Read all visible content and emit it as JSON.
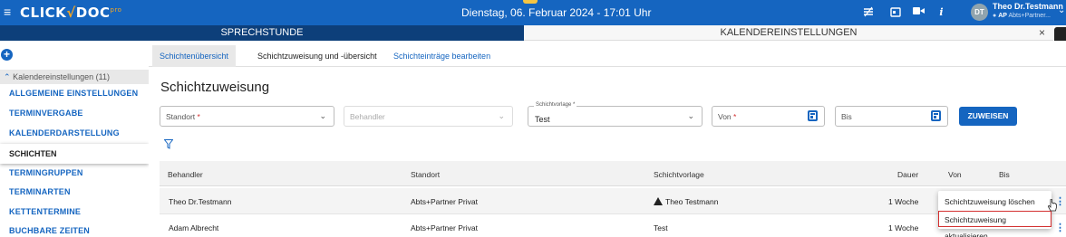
{
  "header": {
    "logo_main": "CLICK",
    "logo_check": "√",
    "logo_doc": "DOC",
    "logo_sup": "pro",
    "date": "Dienstag, 06. Februar 2024 - 17:01 Uhr",
    "user_initials": "DT",
    "user_name": "Theo Dr.Testmann",
    "user_role": "AP",
    "user_org": "Abts+Partner..."
  },
  "main_tabs": {
    "sprechstunde": "SPRECHSTUNDE",
    "kalender": "KALENDEREINSTELLUNGEN",
    "close": "×"
  },
  "sidebar": {
    "group_label": "Kalendereinstellungen (11)",
    "items": [
      "ALLGEMEINE EINSTELLUNGEN",
      "TERMINVERGABE",
      "KALENDERDARSTELLUNG",
      "SCHICHTEN",
      "TERMINGRUPPEN",
      "TERMINARTEN",
      "KETTENTERMINE",
      "BUCHBARE ZEITEN"
    ],
    "active_index": 3
  },
  "sub_tabs": [
    "Schichtenübersicht",
    "Schichtzuweisung und -übersicht",
    "Schichteinträge bearbeiten"
  ],
  "page_title": "Schichtzuweisung",
  "form": {
    "standort_placeholder": "Standort",
    "behandler_placeholder": "Behandler",
    "schichtvorlage_label": "Schichtvorlage *",
    "schichtvorlage_value": "Test",
    "von_placeholder": "Von",
    "bis_placeholder": "Bis",
    "required_mark": "*",
    "assign_button": "ZUWEISEN"
  },
  "table": {
    "headers": [
      "Behandler",
      "Standort",
      "Schichtvorlage",
      "Dauer",
      "Von",
      "Bis"
    ],
    "rows": [
      {
        "behandler": "Theo Dr.Testmann",
        "standort": "Abts+Partner Privat",
        "schichtvorlage": "Theo Testmann",
        "dauer": "1 Woche",
        "warning": true
      },
      {
        "behandler": "Adam Albrecht",
        "standort": "Abts+Partner Privat",
        "schichtvorlage": "Test",
        "dauer": "1 Woche",
        "warning": false
      }
    ]
  },
  "context_menu": {
    "items": [
      "Schichtzuweisung löschen",
      "Schichtzuweisung aktualisieren"
    ],
    "highlighted_index": 1
  },
  "colors": {
    "primary": "#1565c0",
    "dark_tab": "#0d3f7a",
    "accent": "#f5a623",
    "highlight_border": "#d32f2f"
  },
  "icons": [
    "menu-icon",
    "mouse-icon",
    "calendar-icon",
    "video-icon",
    "info-icon",
    "chevron-down-icon",
    "plus-icon",
    "filter-icon",
    "warning-icon",
    "kebab-menu-icon",
    "hand-cursor-icon"
  ]
}
